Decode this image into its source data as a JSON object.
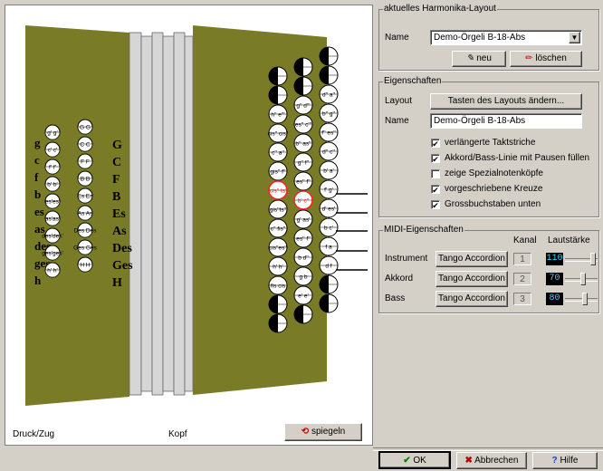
{
  "left_panel": {
    "status_left": "Druck/Zug",
    "status_mid": "Kopf",
    "spiegeln_label": "spiegeln",
    "bass_big_letters": [
      "G",
      "C",
      "F",
      "B",
      "Es",
      "As",
      "Des",
      "Ges",
      "H"
    ],
    "bass_small_letters": [
      "g",
      "c",
      "f",
      "b",
      "es",
      "as",
      "des",
      "ges",
      "h"
    ],
    "bass_col1": [
      "g' g'",
      "c' c'",
      "f' f'",
      "b' b'",
      "es'es'",
      "as'as'",
      "des'des'",
      "ges'ges'",
      "h' h'"
    ],
    "bass_col2": [
      "G G",
      "C C",
      "F F",
      "B B",
      "Es Es",
      "As As",
      "Des Des",
      "Ges Ges",
      "H H"
    ],
    "treble_col1": [
      "",
      "",
      "h'' e'''",
      "cis'' cis''",
      "c'' a''",
      "gis'' f''",
      "cis'' ts'",
      "gis''ts''",
      "c'' fis''",
      "cis''es''",
      "h' h'",
      "fis cis",
      "",
      ""
    ],
    "treble_col2": [
      "",
      "",
      "g'' d'''",
      "es'' c'''",
      "b'' as''",
      "g'' f''",
      "es'' f''",
      "b' c''",
      "g' as'",
      "es'' f''",
      "b d''",
      "g b",
      "e' e'",
      ""
    ],
    "treble_col3": [
      "",
      "",
      "d'' a''",
      "b'' g''",
      "f'' es''",
      "d'' c''",
      "b' a'",
      "f' g'",
      "d' es'",
      "b c'",
      "f a",
      "d f",
      "",
      ""
    ]
  },
  "harmonika_layout": {
    "title": "aktuelles Harmonika-Layout",
    "name_label": "Name",
    "name_value": "Demo-Örgeli B-18-Abs",
    "neu_label": "neu",
    "loeschen_label": "löschen"
  },
  "eigenschaften": {
    "title": "Eigenschaften",
    "layout_label": "Layout",
    "layout_button": "Tasten des Layouts ändern...",
    "name_label": "Name",
    "name_value": "Demo-Örgeli B-18-Abs",
    "options": [
      {
        "label": "verlängerte Taktstriche",
        "checked": true
      },
      {
        "label": "Akkord/Bass-Linie mit Pausen füllen",
        "checked": true
      },
      {
        "label": "zeige Spezialnotenköpfe",
        "checked": false
      },
      {
        "label": "vorgeschriebene Kreuze",
        "checked": true
      },
      {
        "label": "Grossbuchstaben unten",
        "checked": true
      }
    ]
  },
  "midi": {
    "title": "MIDI-Eigenschaften",
    "kanal_header": "Kanal",
    "laut_header": "Lautstärke",
    "rows": [
      {
        "label": "Instrument",
        "instrument": "Tango Accordion",
        "kanal": "1",
        "volume": "110",
        "level": 0.92
      },
      {
        "label": "Akkord",
        "instrument": "Tango Accordion",
        "kanal": "2",
        "volume": "70",
        "level": 0.55
      },
      {
        "label": "Bass",
        "instrument": "Tango Accordion",
        "kanal": "3",
        "volume": "80",
        "level": 0.63
      }
    ]
  },
  "footer": {
    "ok": "OK",
    "abbrechen": "Abbrechen",
    "hilfe": "Hilfe"
  },
  "colors": {
    "body": "#7a7b26",
    "bellows": "#d6d6d6",
    "highlight": "#ff2020"
  }
}
